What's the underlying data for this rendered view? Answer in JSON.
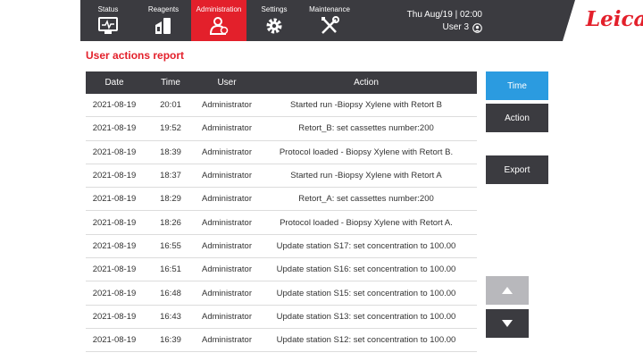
{
  "nav": {
    "tabs": [
      {
        "label": "Status",
        "icon": "status-monitor-icon"
      },
      {
        "label": "Reagents",
        "icon": "reagent-bottle-icon"
      },
      {
        "label": "Administration",
        "icon": "admin-users-icon",
        "active": true
      },
      {
        "label": "Settings",
        "icon": "gear-icon"
      },
      {
        "label": "Maintenance",
        "icon": "wrench-screwdriver-icon"
      }
    ],
    "datetime": "Thu Aug/19 | 02:00",
    "user": "User 3",
    "logo": "Leica"
  },
  "colors": {
    "accent_red": "#e3202b",
    "bar_dark": "#3b3b40",
    "button_blue": "#2b9be0"
  },
  "report": {
    "title": "User actions report",
    "columns": {
      "date": "Date",
      "time": "Time",
      "user": "User",
      "action": "Action"
    },
    "rows": [
      {
        "date": "2021-08-19",
        "time": "20:01",
        "user": "Administrator",
        "action": "Started run -Biopsy Xylene with Retort B"
      },
      {
        "date": "2021-08-19",
        "time": "19:52",
        "user": "Administrator",
        "action": "Retort_B: set cassettes number:200"
      },
      {
        "date": "2021-08-19",
        "time": "18:39",
        "user": "Administrator",
        "action": "Protocol loaded - Biopsy Xylene with Retort B."
      },
      {
        "date": "2021-08-19",
        "time": "18:37",
        "user": "Administrator",
        "action": "Started run -Biopsy Xylene with Retort A"
      },
      {
        "date": "2021-08-19",
        "time": "18:29",
        "user": "Administrator",
        "action": "Retort_A: set cassettes number:200"
      },
      {
        "date": "2021-08-19",
        "time": "18:26",
        "user": "Administrator",
        "action": "Protocol loaded - Biopsy Xylene with Retort A."
      },
      {
        "date": "2021-08-19",
        "time": "16:55",
        "user": "Administrator",
        "action": "Update station S17: set concentration to 100.00"
      },
      {
        "date": "2021-08-19",
        "time": "16:51",
        "user": "Administrator",
        "action": "Update station S16: set concentration to 100.00"
      },
      {
        "date": "2021-08-19",
        "time": "16:48",
        "user": "Administrator",
        "action": "Update station S15: set concentration to 100.00"
      },
      {
        "date": "2021-08-19",
        "time": "16:43",
        "user": "Administrator",
        "action": "Update station S13: set concentration to 100.00"
      },
      {
        "date": "2021-08-19",
        "time": "16:39",
        "user": "Administrator",
        "action": "Update station S12: set concentration to 100.00"
      }
    ]
  },
  "side": {
    "time_label": "Time",
    "action_label": "Action",
    "export_label": "Export"
  },
  "scroll": {
    "up_icon": "arrow-up-icon",
    "down_icon": "arrow-down-icon"
  }
}
